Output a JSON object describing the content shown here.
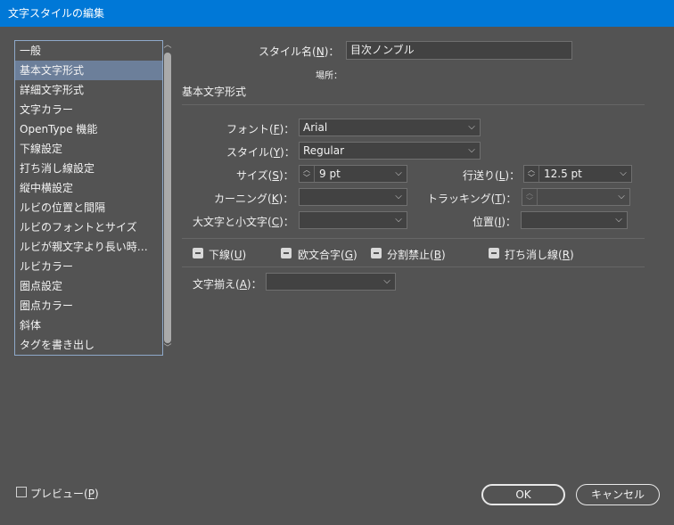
{
  "window": {
    "title": "文字スタイルの編集"
  },
  "sidebar": {
    "items": [
      {
        "label": "一般"
      },
      {
        "label": "基本文字形式",
        "selected": true
      },
      {
        "label": "詳細文字形式"
      },
      {
        "label": "文字カラー"
      },
      {
        "label": "OpenType 機能"
      },
      {
        "label": "下線設定"
      },
      {
        "label": "打ち消し線設定"
      },
      {
        "label": "縦中横設定"
      },
      {
        "label": "ルビの位置と間隔"
      },
      {
        "label": "ルビのフォントとサイズ"
      },
      {
        "label": "ルビが親文字より長い時…"
      },
      {
        "label": "ルビカラー"
      },
      {
        "label": "圏点設定"
      },
      {
        "label": "圏点カラー"
      },
      {
        "label": "斜体"
      },
      {
        "label": "タグを書き出し"
      }
    ]
  },
  "style_name": {
    "label": "スタイル名",
    "key": "N",
    "value": "目次ノンブル"
  },
  "location": {
    "label": "場所："
  },
  "section": {
    "title": "基本文字形式"
  },
  "font": {
    "label": "フォント",
    "key": "F",
    "value": "Arial"
  },
  "style": {
    "label": "スタイル",
    "key": "Y",
    "value": "Regular"
  },
  "size": {
    "label": "サイズ",
    "key": "S",
    "value": "9 pt"
  },
  "leading": {
    "label": "行送り",
    "key": "L",
    "value": "12.5 pt"
  },
  "kerning": {
    "label": "カーニング",
    "key": "K",
    "value": ""
  },
  "tracking": {
    "label": "トラッキング",
    "key": "T",
    "value": ""
  },
  "case": {
    "label": "大文字と小文字",
    "key": "C",
    "value": ""
  },
  "position": {
    "label": "位置",
    "key": "I",
    "value": ""
  },
  "checks": {
    "underline": {
      "label": "下線",
      "key": "U"
    },
    "ligatures": {
      "label": "欧文合字",
      "key": "G"
    },
    "nobreak": {
      "label": "分割禁止",
      "key": "B"
    },
    "strikethrough": {
      "label": "打ち消し線",
      "key": "R"
    }
  },
  "alignment": {
    "label": "文字揃え",
    "key": "A",
    "value": ""
  },
  "preview": {
    "label": "プレビュー",
    "key": "P",
    "checked": false
  },
  "buttons": {
    "ok": "OK",
    "cancel": "キャンセル"
  },
  "colors": {
    "titlebar": "#0078d7",
    "background": "#535353",
    "selection": "#6c7f9a"
  }
}
